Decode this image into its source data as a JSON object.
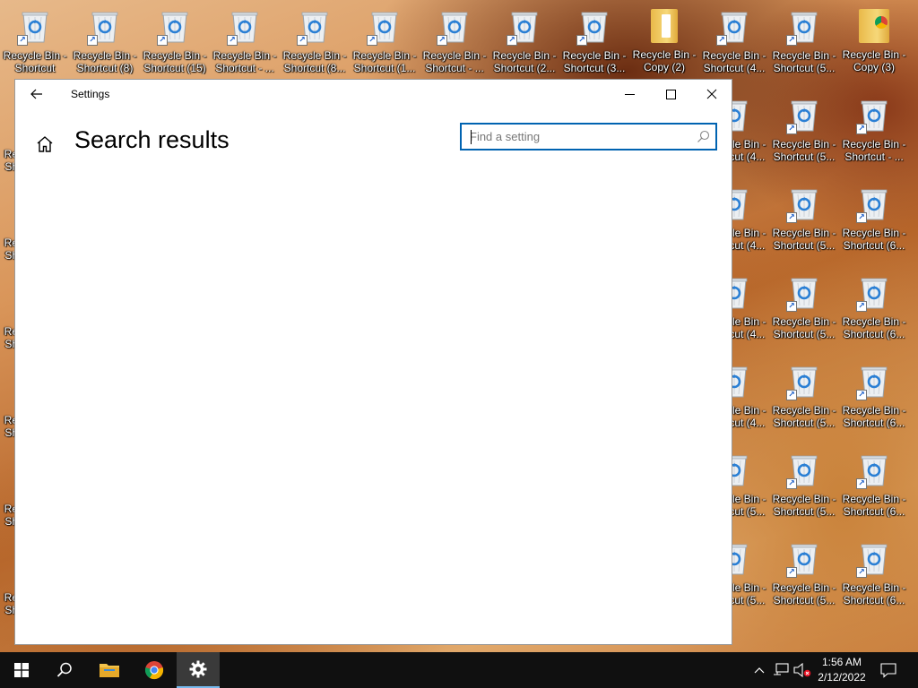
{
  "desktop": {
    "row1": [
      {
        "label1": "Recycle Bin -",
        "label2": "Shortcut",
        "type": "bin"
      },
      {
        "label1": "Recycle Bin -",
        "label2": "Shortcut (8)",
        "type": "bin"
      },
      {
        "label1": "Recycle Bin -",
        "label2": "Shortcut (15)",
        "type": "bin"
      },
      {
        "label1": "Recycle Bin -",
        "label2": "Shortcut - ...",
        "type": "bin"
      },
      {
        "label1": "Recycle Bin -",
        "label2": "Shortcut (8...",
        "type": "bin"
      },
      {
        "label1": "Recycle Bin -",
        "label2": "Shortcut (1...",
        "type": "bin"
      },
      {
        "label1": "Recycle Bin -",
        "label2": "Shortcut - ...",
        "type": "bin"
      },
      {
        "label1": "Recycle Bin -",
        "label2": "Shortcut (2...",
        "type": "bin"
      },
      {
        "label1": "Recycle Bin -",
        "label2": "Shortcut (3...",
        "type": "bin"
      },
      {
        "label1": "Recycle Bin -",
        "label2": "Copy (2)",
        "type": "folder"
      },
      {
        "label1": "Recycle Bin -",
        "label2": "Shortcut (4...",
        "type": "bin"
      },
      {
        "label1": "Recycle Bin -",
        "label2": "Shortcut (5...",
        "type": "bin"
      },
      {
        "label1": "Recycle Bin -",
        "label2": "Copy (3)",
        "type": "folder-chrome"
      }
    ],
    "col_a": [
      {
        "label1": "Recycle Bin -",
        "label2": "Shortcut (4..."
      },
      {
        "label1": "Recycle Bin -",
        "label2": "Shortcut (4..."
      },
      {
        "label1": "Recycle Bin -",
        "label2": "Shortcut (4..."
      },
      {
        "label1": "Recycle Bin -",
        "label2": "Shortcut (4..."
      },
      {
        "label1": "Recycle Bin -",
        "label2": "Shortcut (5..."
      },
      {
        "label1": "Recycle Bin -",
        "label2": "Shortcut (5..."
      }
    ],
    "col_b": [
      {
        "label1": "Recycle Bin -",
        "label2": "Shortcut (5..."
      },
      {
        "label1": "Recycle Bin -",
        "label2": "Shortcut (5..."
      },
      {
        "label1": "Recycle Bin -",
        "label2": "Shortcut (5..."
      },
      {
        "label1": "Recycle Bin -",
        "label2": "Shortcut (5..."
      },
      {
        "label1": "Recycle Bin -",
        "label2": "Shortcut (5..."
      },
      {
        "label1": "Recycle Bin -",
        "label2": "Shortcut (5..."
      }
    ],
    "col_c": [
      {
        "label1": "Recycle Bin -",
        "label2": "Shortcut - ..."
      },
      {
        "label1": "Recycle Bin -",
        "label2": "Shortcut (6..."
      },
      {
        "label1": "Recycle Bin -",
        "label2": "Shortcut (6..."
      },
      {
        "label1": "Recycle Bin -",
        "label2": "Shortcut (6..."
      },
      {
        "label1": "Recycle Bin -",
        "label2": "Shortcut (6..."
      },
      {
        "label1": "Recycle Bin -",
        "label2": "Shortcut (6..."
      }
    ],
    "left_edge_label1": "Re",
    "left_edge_label2": "Sh"
  },
  "settings": {
    "window_title": "Settings",
    "page_title": "Search results",
    "search_placeholder": "Find a setting",
    "search_value": "",
    "icons": {
      "back": "back-arrow-icon",
      "home": "home-icon",
      "search": "search-icon",
      "minimize": "minimize-icon",
      "maximize": "maximize-icon",
      "close": "close-icon"
    },
    "accent_color": "#0063b1"
  },
  "taskbar": {
    "time": "1:56 AM",
    "date": "2/12/2022",
    "active_app": "settings",
    "accent_color": "#76b9ed"
  }
}
